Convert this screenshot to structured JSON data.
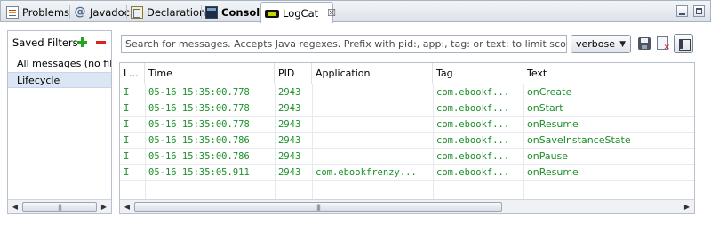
{
  "tabs": [
    {
      "label": "Problems",
      "icon": "problems-icon",
      "active": false
    },
    {
      "label": "Javadoc",
      "icon": "javadoc-icon",
      "active": false
    },
    {
      "label": "Declaration",
      "icon": "declaration-icon",
      "active": false
    },
    {
      "label": "Console",
      "icon": "console-icon",
      "active": false
    },
    {
      "label": "LogCat",
      "icon": "logcat-icon",
      "active": true,
      "close_glyph": "☒"
    }
  ],
  "window_controls": {
    "minimize": "minimize-icon",
    "maximize": "maximize-icon"
  },
  "filters": {
    "title": "Saved Filters",
    "items": [
      {
        "label": "All messages (no filters)",
        "selected": false
      },
      {
        "label": "Lifecycle",
        "selected": true
      }
    ]
  },
  "search": {
    "placeholder": "Search for messages. Accepts Java regexes. Prefix with pid:, app:, tag: or text: to limit scope.",
    "value": ""
  },
  "log_level": {
    "selected": "verbose"
  },
  "toolbar": {
    "save": "save-icon",
    "clear": "clear-log-icon",
    "toggle": "toggle-panel-icon"
  },
  "table": {
    "columns": [
      "L...",
      "Time",
      "PID",
      "Application",
      "Tag",
      "Text"
    ],
    "rows": [
      {
        "level": "I",
        "time": "05-16 15:35:00.778",
        "pid": "2943",
        "app": "",
        "tag": "com.ebookf...",
        "text": "onCreate"
      },
      {
        "level": "I",
        "time": "05-16 15:35:00.778",
        "pid": "2943",
        "app": "",
        "tag": "com.ebookf...",
        "text": "onStart"
      },
      {
        "level": "I",
        "time": "05-16 15:35:00.778",
        "pid": "2943",
        "app": "",
        "tag": "com.ebookf...",
        "text": "onResume"
      },
      {
        "level": "I",
        "time": "05-16 15:35:00.786",
        "pid": "2943",
        "app": "",
        "tag": "com.ebookf...",
        "text": "onSaveInstanceState"
      },
      {
        "level": "I",
        "time": "05-16 15:35:00.786",
        "pid": "2943",
        "app": "",
        "tag": "com.ebookf...",
        "text": "onPause"
      },
      {
        "level": "I",
        "time": "05-16 15:35:05.911",
        "pid": "2943",
        "app": "com.ebookfrenzy...",
        "tag": "com.ebookf...",
        "text": "onResume"
      }
    ]
  },
  "colors": {
    "log_info": "#1d8f2a",
    "selection": "#dbe6f4",
    "tab_border": "#a9b4c2"
  }
}
